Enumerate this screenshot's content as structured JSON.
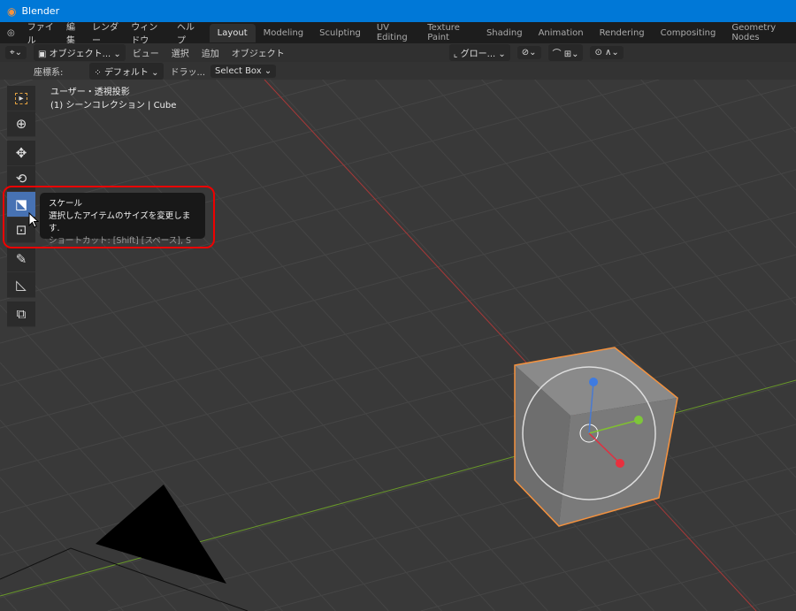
{
  "window": {
    "title": "Blender"
  },
  "menu": {
    "items": [
      "ファイル",
      "編集",
      "レンダー",
      "ウィンドウ",
      "ヘルプ"
    ]
  },
  "workspaces": [
    "Layout",
    "Modeling",
    "Sculpting",
    "UV Editing",
    "Texture Paint",
    "Shading",
    "Animation",
    "Rendering",
    "Compositing",
    "Geometry Nodes"
  ],
  "header": {
    "mode": "オブジェクト...",
    "view": "ビュー",
    "select": "選択",
    "add": "追加",
    "object": "オブジェクト",
    "orientation": "グロー..."
  },
  "toolsettings": {
    "coord_label": "座標系:",
    "coord_value": "デフォルト",
    "drag_label": "ドラッ...",
    "select_mode": "Select Box"
  },
  "viewport": {
    "view_name": "ユーザー・透視投影",
    "collection": "(1) シーンコレクション | Cube"
  },
  "tooltip": {
    "title": "スケール",
    "description": "選択したアイテムのサイズを変更します.",
    "shortcut": "ショートカット: [Shift] [スペース], S"
  },
  "colors": {
    "accent": "#4772b3",
    "selection": "#f5923e",
    "highlight": "#e00000",
    "x_axis": "#a83838",
    "y_axis": "#6a9a2a"
  }
}
